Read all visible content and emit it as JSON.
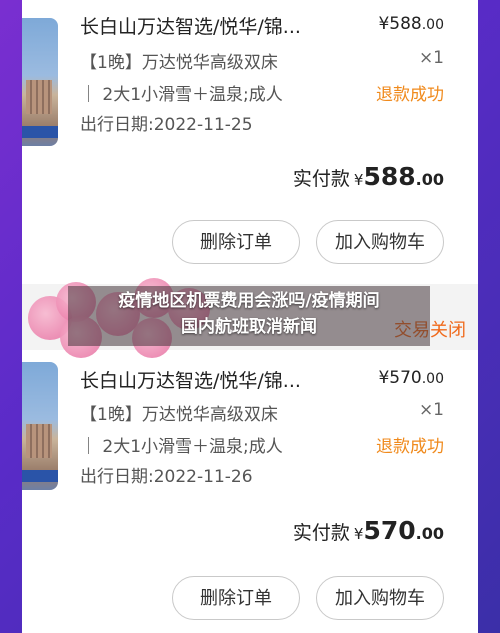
{
  "banner": {
    "line1": "疫情地区机票费用会涨吗/疫情期间",
    "line2": "国内航班取消新闻"
  },
  "orders": [
    {
      "title": "长白山万达智选/悦华/锦...",
      "price": "¥588",
      "price_dec": ".00",
      "spec_line1": "【1晚】万达悦华高级双床",
      "spec_line2": "｜ 2大1小滑雪＋温泉;成人",
      "spec_line3": "出行日期:2022-11-25",
      "qty": "×1",
      "refund_status": "退款成功",
      "paid_label": "实付款",
      "paid_currency": "¥",
      "paid_amount": "588",
      "paid_dec": ".00",
      "btn_delete": "删除订单",
      "btn_cart": "加入购物车"
    },
    {
      "title": "长白山万达智选/悦华/锦...",
      "price": "¥570",
      "price_dec": ".00",
      "spec_line1": "【1晚】万达悦华高级双床",
      "spec_line2": "｜ 2大1小滑雪＋温泉;成人",
      "spec_line3": "出行日期:2022-11-26",
      "qty": "×1",
      "refund_status": "退款成功",
      "paid_label": "实付款",
      "paid_currency": "¥",
      "paid_amount": "570",
      "paid_dec": ".00",
      "btn_delete": "删除订单",
      "btn_cart": "加入购物车"
    }
  ],
  "order2_status": "交易关闭",
  "colors": {
    "accent_orange": "#f08a1c",
    "background_purple": "#5a2bc8"
  }
}
